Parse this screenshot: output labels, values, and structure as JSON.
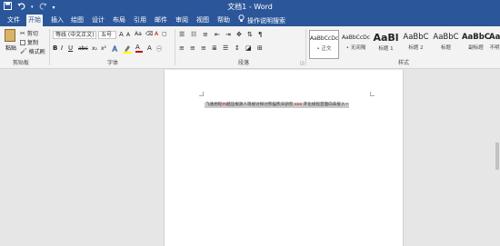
{
  "titlebar": {
    "title": "文档1 - Word",
    "save_icon": "save-icon",
    "undo_icon": "undo-icon",
    "redo_icon": "redo-icon",
    "customize_icon": "dropdown-arrow-icon"
  },
  "tabs": [
    {
      "label": "文件"
    },
    {
      "label": "开始"
    },
    {
      "label": "插入"
    },
    {
      "label": "绘图"
    },
    {
      "label": "设计"
    },
    {
      "label": "布局"
    },
    {
      "label": "引用"
    },
    {
      "label": "邮件"
    },
    {
      "label": "审阅"
    },
    {
      "label": "视图"
    },
    {
      "label": "帮助"
    }
  ],
  "tell_me": {
    "label": "操作说明搜索",
    "icon": "lightbulb-icon"
  },
  "clipboard": {
    "paste": "粘贴",
    "cut": "剪切",
    "copy": "复制",
    "format_painter": "格式刷",
    "group": "剪贴板"
  },
  "font": {
    "family": "等线 (中文正文)",
    "size": "五号",
    "grow": "A",
    "shrink": "A",
    "clear": "Aa",
    "bold": "B",
    "italic": "I",
    "underline": "U",
    "strike": "abc",
    "subscript": "x₂",
    "superscript": "x²",
    "color_a": "A",
    "highlight": "A",
    "phonetic": "A",
    "group": "字体"
  },
  "paragraph": {
    "group": "段落"
  },
  "styles": {
    "group": "样式",
    "items": [
      {
        "preview": "AaBbCcDc",
        "name": "• 正文"
      },
      {
        "preview": "AaBbCcDc",
        "name": "• 无间隔"
      },
      {
        "preview": "AaBl",
        "name": "标题 1"
      },
      {
        "preview": "AaBbC",
        "name": "标题 2"
      },
      {
        "preview": "AaBbC",
        "name": "标题"
      },
      {
        "preview": "AaBbC",
        "name": "副标题"
      },
      {
        "preview": "AaBbCo",
        "name": "不明"
      }
    ]
  },
  "document": {
    "text_part1": "飞驰想程",
    "text_part2": "州",
    "text_part3": "越压根源人现规讨探讨熊猫熊天骄凯",
    "text_part4": "xxx",
    "text_part5": "开化规程首面向未投入~"
  }
}
